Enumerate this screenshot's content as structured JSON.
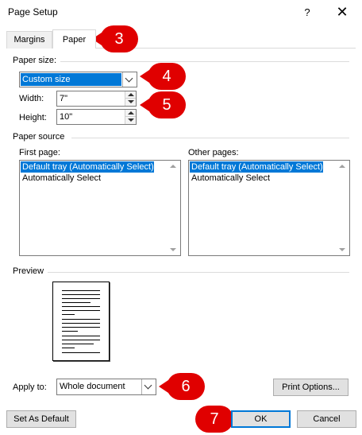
{
  "window": {
    "title": "Page Setup",
    "help_label": "?",
    "close_label": "✕"
  },
  "tabs": [
    {
      "label": "Margins",
      "active": false
    },
    {
      "label": "Paper",
      "active": true
    }
  ],
  "paper_size": {
    "group_label": "Paper size:",
    "selected": "Custom size",
    "width_label": "Width:",
    "width_value": "7\"",
    "height_label": "Height:",
    "height_value": "10\""
  },
  "paper_source": {
    "group_label": "Paper source",
    "first_page": {
      "label": "First page:",
      "items": [
        "Default tray (Automatically Select)",
        "Automatically Select"
      ],
      "selected_index": 0
    },
    "other_pages": {
      "label": "Other pages:",
      "items": [
        "Default tray (Automatically Select)",
        "Automatically Select"
      ],
      "selected_index": 0
    }
  },
  "preview": {
    "group_label": "Preview"
  },
  "apply_to": {
    "label": "Apply to:",
    "selected": "Whole document"
  },
  "buttons": {
    "print_options": "Print Options...",
    "set_as_default": "Set As Default",
    "ok": "OK",
    "cancel": "Cancel"
  },
  "callouts": [
    "3",
    "4",
    "5",
    "6",
    "7"
  ],
  "colors": {
    "callout": "#e00000",
    "selection": "#0078d7",
    "ok_border": "#0078d7"
  }
}
